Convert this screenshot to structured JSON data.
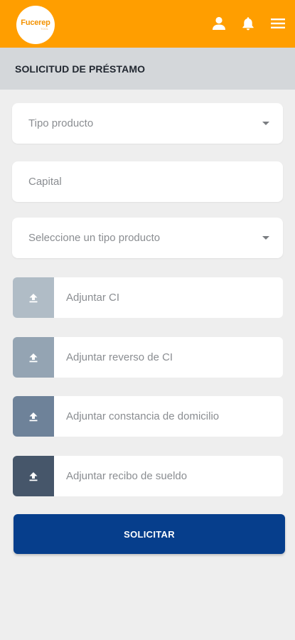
{
  "header": {
    "logo_text": "Fucerep",
    "logo_subtext": "TOOL",
    "icons": [
      "user-icon",
      "bell-icon",
      "menu-icon"
    ],
    "background_color": "#ff9e00"
  },
  "page": {
    "title": "SOLICITUD DE PRÉSTAMO"
  },
  "form": {
    "product_type_placeholder": "Tipo producto",
    "capital_placeholder": "Capital",
    "product_subtype_placeholder": "Seleccione un tipo producto",
    "uploads": [
      {
        "label": "Adjuntar CI",
        "button_color": "#b0bcc6"
      },
      {
        "label": "Adjuntar reverso de CI",
        "button_color": "#94a4b3"
      },
      {
        "label": "Adjuntar constancia de domicilio",
        "button_color": "#6e8299"
      },
      {
        "label": "Adjuntar recibo de sueldo",
        "button_color": "#46566a"
      }
    ],
    "submit_label": "SOLICITAR",
    "submit_color": "#063e8c"
  }
}
